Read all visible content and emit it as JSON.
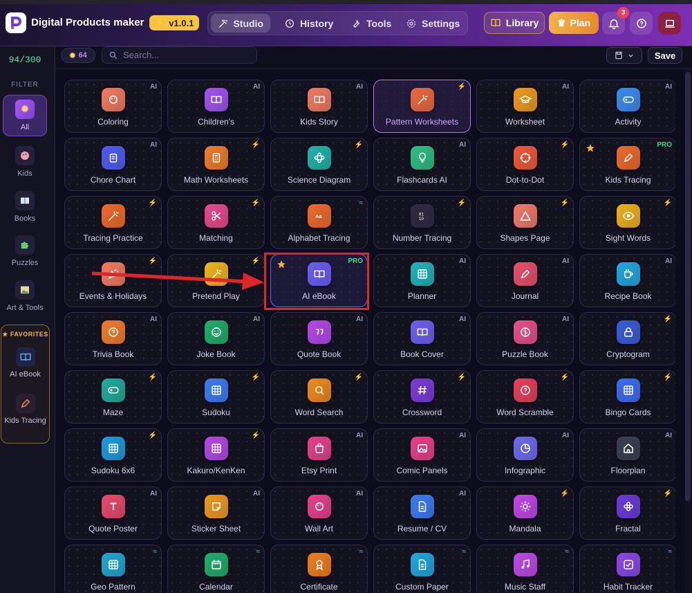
{
  "header": {
    "app_title": "Digital Products maker",
    "version": "v1.0.1",
    "nav": [
      {
        "label": "Studio",
        "icon": "magic-wand-icon",
        "active": true
      },
      {
        "label": "History",
        "icon": "history-icon",
        "active": false
      },
      {
        "label": "Tools",
        "icon": "wrench-icon",
        "active": false
      },
      {
        "label": "Settings",
        "icon": "gear-icon",
        "active": false
      }
    ],
    "library_label": "Library",
    "plan_label": "Plan",
    "notification_count": "3"
  },
  "sidebar": {
    "counter": "94/300",
    "filter_label": "FILTER",
    "items": [
      {
        "label": "All",
        "icon": "sparkle-icon",
        "active": true
      },
      {
        "label": "Kids",
        "icon": "palette-icon",
        "active": false
      },
      {
        "label": "Books",
        "icon": "book-icon",
        "active": false
      },
      {
        "label": "Puzzles",
        "icon": "puzzle-icon",
        "active": false
      },
      {
        "label": "Art & Tools",
        "icon": "picture-icon",
        "active": false
      }
    ],
    "favorites_label": "FAVORITES",
    "favorites": [
      {
        "label": "AI eBook",
        "icon": "open-book-icon"
      },
      {
        "label": "Kids Tracing",
        "icon": "pen-icon"
      }
    ]
  },
  "toolbar": {
    "credits": "64",
    "search_placeholder": "Search...",
    "save_label": "Save"
  },
  "colors": {
    "accent": "#a879f0",
    "annotation_red": "#e0262b",
    "pro_green": "#39d98a"
  },
  "cards": [
    {
      "label": "Coloring",
      "tag": "AI",
      "icon": "palette-icon",
      "color": "#f27a5e"
    },
    {
      "label": "Children's",
      "tag": "AI",
      "icon": "open-book-icon",
      "color": "#a155f0"
    },
    {
      "label": "Kids Story",
      "tag": "AI",
      "icon": "open-book-icon",
      "color": "#f27a5e"
    },
    {
      "label": "Pattern Worksheets",
      "tag": "bolt",
      "icon": "magic-wand-icon",
      "color": "#e8693a",
      "selected": true
    },
    {
      "label": "Worksheet",
      "tag": "AI",
      "icon": "graduation-cap-icon",
      "color": "#ef9a1c"
    },
    {
      "label": "Activity",
      "tag": "AI",
      "icon": "gamepad-icon",
      "color": "#3b8cf0"
    },
    {
      "label": "Chore Chart",
      "tag": "AI",
      "icon": "clipboard-icon",
      "color": "#4e5ef0"
    },
    {
      "label": "Math Worksheets",
      "tag": "bolt",
      "icon": "calculator-icon",
      "color": "#ef7d2a"
    },
    {
      "label": "Science Diagram",
      "tag": "bolt",
      "icon": "atom-icon",
      "color": "#1fb5a8"
    },
    {
      "label": "Flashcards AI",
      "tag": "AI",
      "icon": "lightbulb-icon",
      "color": "#2fbf83"
    },
    {
      "label": "Dot-to-Dot",
      "tag": "bolt",
      "icon": "target-icon",
      "color": "#ef5a3a"
    },
    {
      "label": "Kids Tracing",
      "tag": "PRO",
      "icon": "pen-icon",
      "color": "#ef6a2a",
      "star": true
    },
    {
      "label": "Tracing Practice",
      "tag": "bolt",
      "icon": "magic-wand-icon",
      "color": "#ef6a2a"
    },
    {
      "label": "Matching",
      "tag": "bolt",
      "icon": "scissors-icon",
      "color": "#e84a8a"
    },
    {
      "label": "Alphabet Tracing",
      "tag": "wave",
      "icon": "text-icon",
      "color": "#ef6a2a"
    },
    {
      "label": "Number Tracing",
      "tag": "bolt",
      "icon": "number-icon",
      "color": "#2f2a40"
    },
    {
      "label": "Shapes Page",
      "tag": "bolt",
      "icon": "triangle-icon",
      "color": "#f2796a"
    },
    {
      "label": "Sight Words",
      "tag": "bolt",
      "icon": "eye-icon",
      "color": "#efb01c"
    },
    {
      "label": "Events & Holidays",
      "tag": "bolt",
      "icon": "party-icon",
      "color": "#f27a5e"
    },
    {
      "label": "Pretend Play",
      "tag": "bolt",
      "icon": "magic-wand-icon",
      "color": "#f0b41c"
    },
    {
      "label": "AI eBook",
      "tag": "PRO",
      "icon": "open-book-icon",
      "color": "#6c5cf0",
      "star": true,
      "highlight": true
    },
    {
      "label": "Planner",
      "tag": "AI",
      "icon": "grid-icon",
      "color": "#1fb5b8"
    },
    {
      "label": "Journal",
      "tag": "AI",
      "icon": "pen-icon",
      "color": "#e8506a"
    },
    {
      "label": "Recipe Book",
      "tag": "AI",
      "icon": "cup-icon",
      "color": "#22a8e0"
    },
    {
      "label": "Trivia Book",
      "tag": "AI",
      "icon": "question-icon",
      "color": "#ef7d2a"
    },
    {
      "label": "Joke Book",
      "tag": "AI",
      "icon": "smile-icon",
      "color": "#1fae6a"
    },
    {
      "label": "Quote Book",
      "tag": "AI",
      "icon": "quote-icon",
      "color": "#b548e8"
    },
    {
      "label": "Book Cover",
      "tag": "AI",
      "icon": "open-book-icon",
      "color": "#6e5ef0"
    },
    {
      "label": "Puzzle Book",
      "tag": "AI",
      "icon": "brain-icon",
      "color": "#e8508a"
    },
    {
      "label": "Cryptogram",
      "tag": "bolt",
      "icon": "lock-icon",
      "color": "#3a5cd8"
    },
    {
      "label": "Maze",
      "tag": "bolt",
      "icon": "gamepad-icon",
      "color": "#1fae9a"
    },
    {
      "label": "Sudoku",
      "tag": "bolt",
      "icon": "grid-icon",
      "color": "#3b7cf0"
    },
    {
      "label": "Word Search",
      "tag": "bolt",
      "icon": "search-icon",
      "color": "#ef8a1c"
    },
    {
      "label": "Crossword",
      "tag": "bolt",
      "icon": "hash-icon",
      "color": "#7a3cd8"
    },
    {
      "label": "Word Scramble",
      "tag": "bolt",
      "icon": "question-icon",
      "color": "#e8405a"
    },
    {
      "label": "Bingo Cards",
      "tag": "bolt",
      "icon": "grid-icon",
      "color": "#3b6cf0"
    },
    {
      "label": "Sudoku 6x6",
      "tag": "bolt",
      "icon": "grid-icon",
      "color": "#1f9ae0"
    },
    {
      "label": "Kakuro/KenKen",
      "tag": "bolt",
      "icon": "grid-icon",
      "color": "#b548e8"
    },
    {
      "label": "Etsy Print",
      "tag": "AI",
      "icon": "bag-icon",
      "color": "#e8408a"
    },
    {
      "label": "Comic Panels",
      "tag": "AI",
      "icon": "image-icon",
      "color": "#e8408a"
    },
    {
      "label": "Infographic",
      "tag": "AI",
      "icon": "pie-icon",
      "color": "#6c6cf0"
    },
    {
      "label": "Floorplan",
      "tag": "AI",
      "icon": "home-icon",
      "color": "#3a4050"
    },
    {
      "label": "Quote Poster",
      "tag": "AI",
      "icon": "type-icon",
      "color": "#e84a6a"
    },
    {
      "label": "Sticker Sheet",
      "tag": "AI",
      "icon": "sticker-icon",
      "color": "#ef9a1c"
    },
    {
      "label": "Wall Art",
      "tag": "AI",
      "icon": "palette-icon",
      "color": "#e8408a"
    },
    {
      "label": "Resume / CV",
      "tag": "AI",
      "icon": "document-icon",
      "color": "#3b7cf0"
    },
    {
      "label": "Mandala",
      "tag": "bolt",
      "icon": "sun-icon",
      "color": "#c048e8"
    },
    {
      "label": "Fractal",
      "tag": "bolt",
      "icon": "flower-icon",
      "color": "#6a3cd8"
    },
    {
      "label": "Geo Pattern",
      "tag": "wave",
      "icon": "grid-icon",
      "color": "#1fa8d0"
    },
    {
      "label": "Calendar",
      "tag": "wave",
      "icon": "calendar-icon",
      "color": "#1fae6a"
    },
    {
      "label": "Certificate",
      "tag": "wave",
      "icon": "award-icon",
      "color": "#ef7d1c"
    },
    {
      "label": "Custom Paper",
      "tag": "wave",
      "icon": "document-icon",
      "color": "#1fa8e0"
    },
    {
      "label": "Music Staff",
      "tag": "wave",
      "icon": "music-icon",
      "color": "#c048e8"
    },
    {
      "label": "Habit Tracker",
      "tag": "wave",
      "icon": "checkbox-icon",
      "color": "#8a48e8"
    }
  ]
}
